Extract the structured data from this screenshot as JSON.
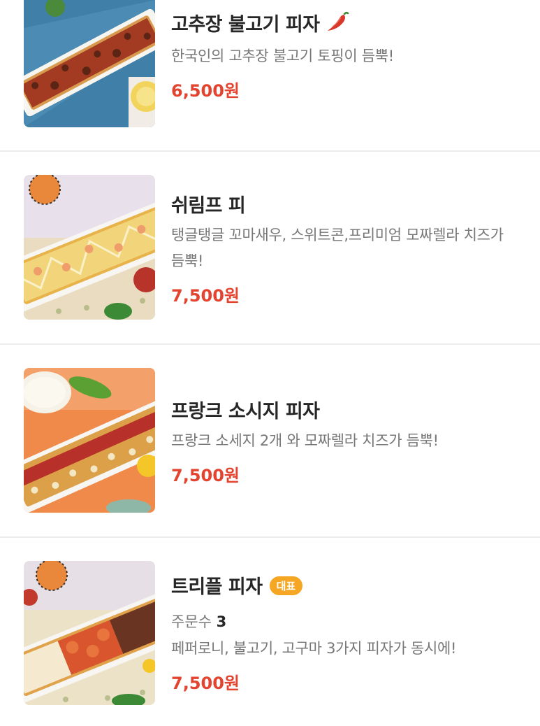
{
  "menu_items": [
    {
      "name": "고추장 불고기 피자",
      "description": "한국인의 고추장 불고기 토핑이 듬뿍!",
      "price": "6,500원",
      "spicy_icon": "chili-pepper-icon"
    },
    {
      "name": "쉬림프 피",
      "description": "탱글탱글 꼬마새우, 스위트콘,프리미엄 모짜렐라 치즈가 듬뿍!",
      "price": "7,500원"
    },
    {
      "name": "프랑크 소시지 피자",
      "description": "프랑크 소세지 2개 와 모짜렐라 치즈가 듬뿍!",
      "price": "7,500원"
    },
    {
      "name": "트리플 피자",
      "badge": "대표",
      "orders_label": "주문수",
      "orders_count": "3",
      "description": "페퍼로니, 불고기, 고구마 3가지 피자가 동시에!",
      "price": "7,500원"
    }
  ],
  "colors": {
    "price": "#e2442f",
    "badge": "#f5a623",
    "title": "#262626",
    "description": "#777777"
  }
}
